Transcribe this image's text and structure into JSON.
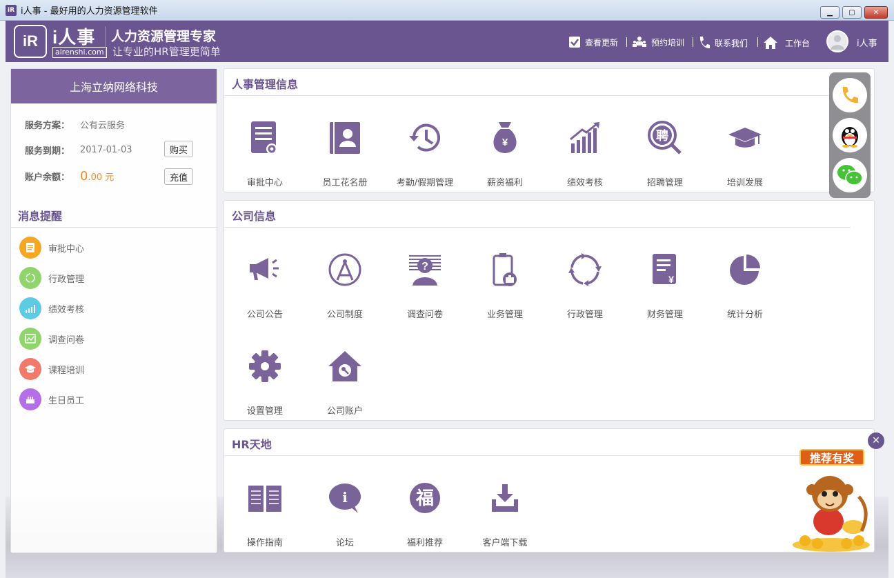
{
  "window": {
    "title": "i人事 - 最好用的人力资源管理软件",
    "icon_text": "iR"
  },
  "header": {
    "logo_text": "iR",
    "brand": "i人事",
    "brand_url": "airenshi.com",
    "slogan_main": "人力资源管理专家",
    "slogan_sub": "让专业的HR管理更简单",
    "nav": [
      {
        "label": "查看更新",
        "icon": "checkbox-icon"
      },
      {
        "label": "预约培训",
        "icon": "training-icon"
      },
      {
        "label": "联系我们",
        "icon": "phone-icon"
      },
      {
        "label": "工作台",
        "icon": "home-icon"
      }
    ],
    "username": "i人事"
  },
  "left": {
    "company": "上海立纳网络科技",
    "plan_label": "服务方案：",
    "plan_value": "公有云服务",
    "expiry_label": "服务到期：",
    "expiry_value": "2017-01-03",
    "buy_button": "购买",
    "balance_label": "账户余额：",
    "balance_int": "0",
    "balance_dec": ".00 元",
    "recharge_button": "充值",
    "messages_title": "消息提醒",
    "messages": [
      {
        "label": "审批中心",
        "color": "#f5a623",
        "icon": "document-icon"
      },
      {
        "label": "行政管理",
        "color": "#8fd56c",
        "icon": "cycle-icon"
      },
      {
        "label": "绩效考核",
        "color": "#5dcbe3",
        "icon": "chart-icon"
      },
      {
        "label": "调查问卷",
        "color": "#8fd56c",
        "icon": "survey-icon"
      },
      {
        "label": "课程培训",
        "color": "#f07b6a",
        "icon": "graduation-icon"
      },
      {
        "label": "生日员工",
        "color": "#b56ee8",
        "icon": "cake-icon"
      }
    ]
  },
  "sections": {
    "hr": {
      "title": "人事管理信息",
      "items": [
        "审批中心",
        "员工花名册",
        "考勤/假期管理",
        "薪资福利",
        "绩效考核",
        "招聘管理",
        "培训发展"
      ]
    },
    "company": {
      "title": "公司信息",
      "items": [
        "公司公告",
        "公司制度",
        "调查问卷",
        "业务管理",
        "行政管理",
        "财务管理",
        "统计分析",
        "设置管理",
        "公司账户"
      ]
    },
    "hrworld": {
      "title": "HR天地",
      "items": [
        "操作指南",
        "论坛",
        "福利推荐",
        "客户端下载"
      ]
    }
  },
  "icon_glyphs": {
    "yen": "¥",
    "hire": "聘",
    "fu": "福",
    "question": "?",
    "forum": "i"
  },
  "promo": {
    "label": "推荐有奖",
    "close": "✕"
  },
  "colors": {
    "primary": "#6b5591",
    "icon": "#7a6399",
    "accent": "#f28c28"
  }
}
